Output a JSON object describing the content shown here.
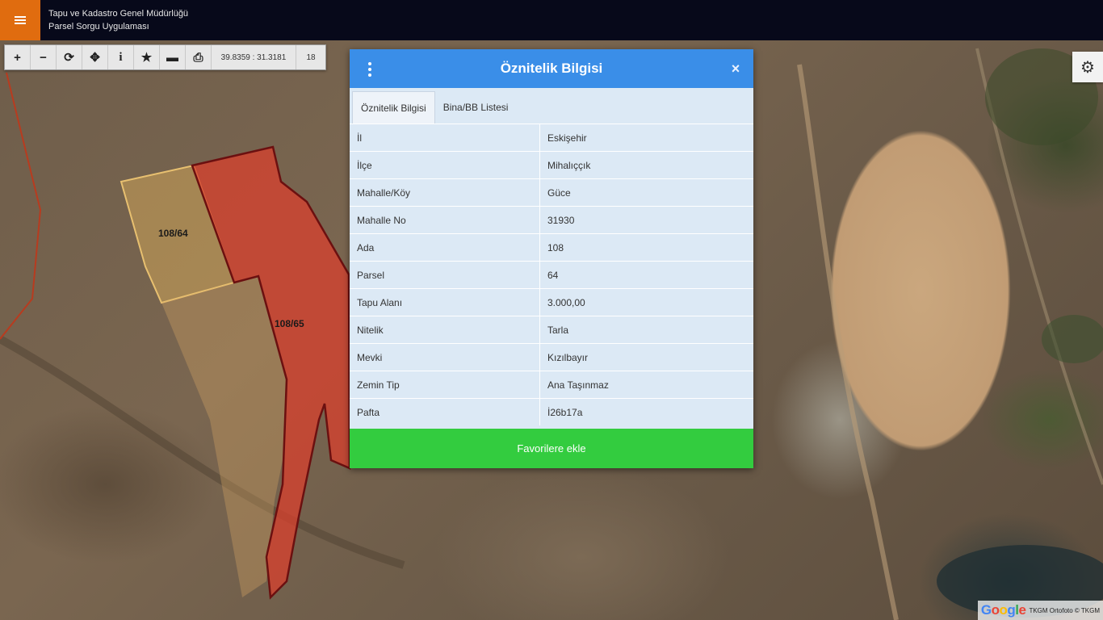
{
  "header": {
    "title_line1": "Tapu ve Kadastro Genel Müdürlüğü",
    "title_line2": "Parsel Sorgu Uygulaması"
  },
  "toolbar": {
    "zoom_in_icon": "+",
    "zoom_out_icon": "−",
    "refresh_icon": "⟳",
    "locate_icon": "✥",
    "info_icon": "i",
    "favorite_icon": "★",
    "measure_icon": "▬",
    "print_icon": "⎙",
    "coordinates": "39.8359 : 31.3181",
    "zoom_level": "18"
  },
  "map": {
    "parcel_labels": [
      "108/64",
      "108/65"
    ],
    "attribution_logo": "Google",
    "attribution_text": "TKGM Ortofoto © TKGM",
    "colors": {
      "selected_parcel": "#d9402e",
      "neighbor_parcel": "#e0b25c",
      "parcel_border": "#6b1010"
    }
  },
  "dialog": {
    "title": "Öznitelik Bilgisi",
    "tabs": [
      {
        "label": "Öznitelik Bilgisi"
      },
      {
        "label": "Bina/BB Listesi"
      }
    ],
    "rows": [
      {
        "key": "İl",
        "value": "Eskişehir"
      },
      {
        "key": "İlçe",
        "value": "Mihalıççık"
      },
      {
        "key": "Mahalle/Köy",
        "value": "Güce"
      },
      {
        "key": "Mahalle No",
        "value": "31930"
      },
      {
        "key": "Ada",
        "value": "108"
      },
      {
        "key": "Parsel",
        "value": "64"
      },
      {
        "key": "Tapu Alanı",
        "value": "3.000,00"
      },
      {
        "key": "Nitelik",
        "value": "Tarla"
      },
      {
        "key": "Mevki",
        "value": "Kızılbayır"
      },
      {
        "key": "Zemin Tip",
        "value": "Ana Taşınmaz"
      },
      {
        "key": "Pafta",
        "value": "İ26b17a"
      }
    ],
    "favorite_button": "Favorilere ekle",
    "close_icon": "×",
    "colors": {
      "header": "#3a8ee8",
      "button": "#33cc3f"
    }
  }
}
